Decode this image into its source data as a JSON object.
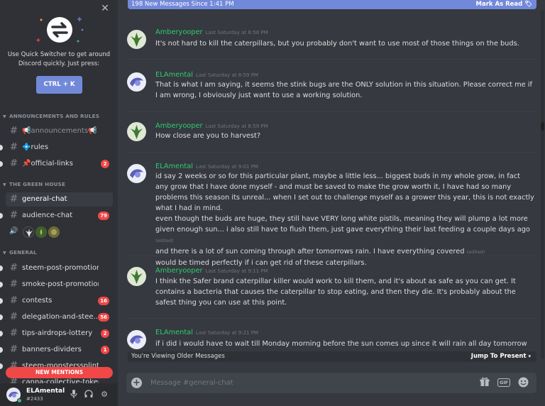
{
  "sidebar": {
    "quick_switcher": {
      "text": "Use Quick Switcher to get around Discord quickly. Just press:",
      "shortcut": "CTRL + K"
    },
    "categories": [
      {
        "name": "ANNOUNCEMENTS AND RULES"
      },
      {
        "name": "THE GREEN HOUSE"
      },
      {
        "name": "GENERAL"
      }
    ],
    "channels": {
      "announcements": {
        "name": "📢announcements📢"
      },
      "rules": {
        "name": "💠rules"
      },
      "official_links": {
        "name": "📌official-links",
        "badge": "2"
      },
      "general_chat": {
        "name": "general-chat"
      },
      "audience_chat": {
        "name": "audience-chat",
        "badge": "79"
      },
      "steem_post_promotion": {
        "name": "steem-post-promotion"
      },
      "smoke_post_promotion": {
        "name": "smoke-post-promotion"
      },
      "contests": {
        "name": "contests",
        "badge": "16"
      },
      "delegation": {
        "name": "delegation-and-stee...",
        "badge": "56"
      },
      "tips_airdrops": {
        "name": "tips-airdrops-lottery",
        "badge": "2"
      },
      "banners_dividers": {
        "name": "banners-dividers",
        "badge": "1"
      },
      "steem_monsters": {
        "name": "steem-monsterssplinterl"
      },
      "canna_collective": {
        "name": "canna-collective-token"
      }
    },
    "new_mentions": "NEW MENTIONS",
    "user": {
      "name": "ELAmental",
      "tag": "#2433"
    }
  },
  "main": {
    "new_messages_bar": {
      "text": "198 New Messages Since 1:41 PM",
      "action": "Mark As Read"
    },
    "messages": [
      {
        "author": "Amberyooper",
        "timestamp": "Last Saturday at 8:58 PM",
        "lines": [
          "It's not hard to kill the caterpillars, but you probably don't want to use most of those things on the buds."
        ]
      },
      {
        "author": "ELAmental",
        "timestamp": "Last Saturday at 8:59 PM",
        "lines": [
          "That is what I am saying, it seems the stink bugs are the ONLY solution in this situation. Please correct me if I am wrong, I obviously just want to use a working solution."
        ]
      },
      {
        "author": "Amberyooper",
        "timestamp": "Last Saturday at 8:59 PM",
        "lines": [
          "How close are you to harvest?"
        ]
      },
      {
        "author": "ELAmental",
        "timestamp": "Last Saturday at 9:01 PM",
        "lines": [
          "id say 2 weeks or so for this particular plant, maybe a little less... biggest buds in my whole grow, in fact any grow that I have done myself - and must be saved to make the grow worth it, I have had so many problems this season its unreal... when I set out to challenge myself as a grower this year, this is not exactly what I had in mind.",
          "even though the buds are huge, they still have VERY long white pistils, meaning they will plump a lot more given enough sun... i also still have to flush them, just gave everything their last feeding a couple days ago",
          "and there is a lot of sun coming through after tomorrows rain. I have everything covered",
          "would be timed perfectly if i can get rid of these caterpillars."
        ],
        "edited": "(edited)"
      },
      {
        "author": "Amberyooper",
        "timestamp": "Last Saturday at 9:11 PM",
        "lines": [
          "I think the Safer brand caterpillar killer would work to kill them, and it's about as safe as you can get.  It contains a bacteria that causes the caterpillar to stop eating, and then they die.  It's probably about the safest thing you can use at this point."
        ]
      },
      {
        "author": "ELAmental",
        "timestamp": "Last Saturday at 9:21 PM",
        "lines": [
          "if i did i would have to wait till Monday morning before the sun comes up since it will rain all day tomorrow"
        ]
      }
    ],
    "older_bar": {
      "text": "You're Viewing Older Messages",
      "action": "Jump To Present"
    },
    "composer": {
      "placeholder": "Message #general-chat"
    }
  },
  "colors": {
    "accent": "#7289da",
    "author": "#2ecc71",
    "badge": "#f04747",
    "online": "#43b581"
  }
}
